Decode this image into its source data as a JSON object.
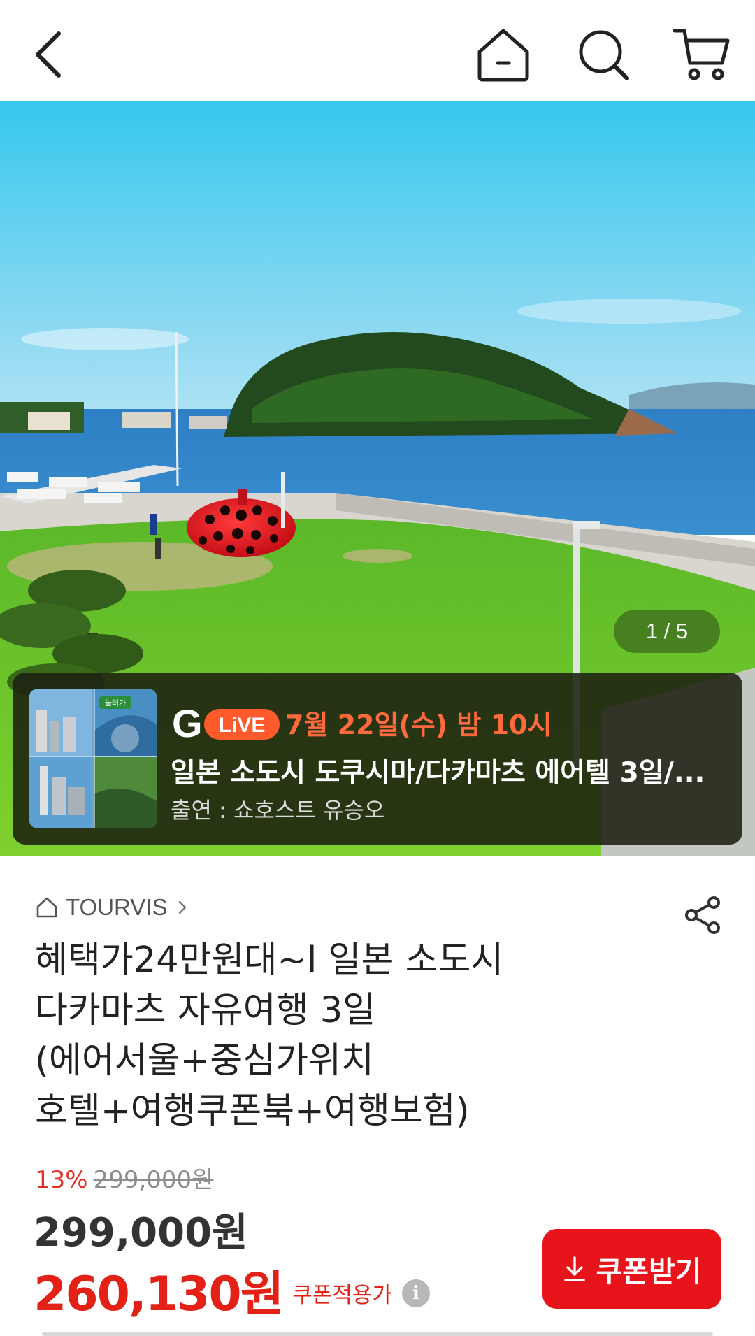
{
  "header": {
    "icons": [
      "back-arrow-icon",
      "home-icon",
      "search-icon",
      "cart-icon"
    ]
  },
  "gallery": {
    "counter": "1 / 5"
  },
  "live_banner": {
    "logo_g": "G",
    "logo_live": "LiVE",
    "thumb_sign": "놀러가",
    "date": "7월 22일(수) 밤 10시",
    "title": "일본 소도시 도쿠시마/다카마츠 에어텔 3일/...",
    "cast": "출연 : 쇼호스트 유승오",
    "accent_color": "#ff6a3d"
  },
  "product": {
    "seller": "TOURVIS",
    "title_lines": [
      "혜택가24만원대~l 일본 소도시",
      "다카마츠 자유여행 3일",
      "(에어서울+중심가위치",
      "호텔+여행쿠폰북+여행보험)"
    ],
    "discount_rate": "13%",
    "original_price": "299,000원",
    "sale_price": "299,000원",
    "coupon_price": "260,130원",
    "coupon_price_label": "쿠폰적용가",
    "info_icon": "i",
    "coupon_button": "쿠폰받기",
    "brand_color": "#e8141c"
  }
}
